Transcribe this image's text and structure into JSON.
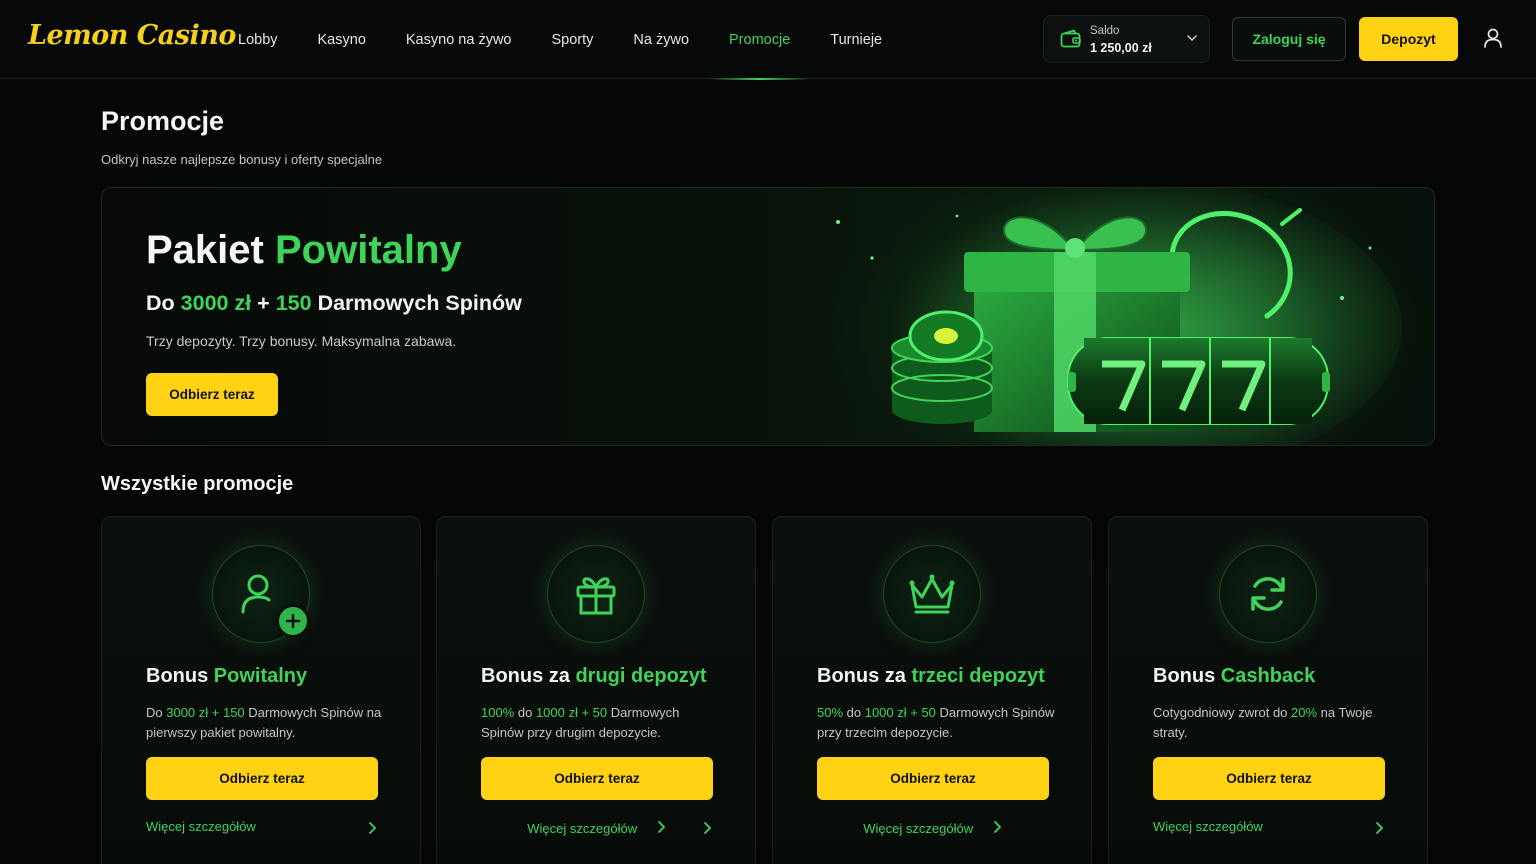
{
  "header": {
    "logo": "Lemon Casino",
    "nav": [
      "Lobby",
      "Kasyno",
      "Kasyno na żywo",
      "Sporty",
      "Na żywo",
      "Promocje",
      "Turnieje"
    ],
    "active_nav": "Promocje",
    "balance_label": "Saldo",
    "balance_value": "1 250,00 zł",
    "login_label": "Zaloguj się",
    "deposit_label": "Depozyt"
  },
  "page": {
    "title": "Promocje",
    "subtitle": "Odkryj nasze najlepsze bonusy i oferty specjalne"
  },
  "hero": {
    "title_white": "Pakiet",
    "title_green": "Powitalny",
    "offer_prefix": "Do",
    "offer_amount": "3000 zł",
    "offer_plus": "+",
    "offer_spins": "150",
    "offer_suffix": "Darmowych Spinów",
    "description": "Trzy depozyty. Trzy bonusy. Maksymalna zabawa.",
    "button": "Odbierz teraz"
  },
  "section_title": "Wszystkie promocje",
  "cards": [
    {
      "icon": "user-plus-icon",
      "title_white": "Bonus",
      "title_green": "Powitalny",
      "desc": [
        "Do ",
        "3000 zł + 150",
        " Darmowych Spinów na pierwszy pakiet powitalny."
      ],
      "button": "Odbierz teraz",
      "link": "Więcej szczegółów"
    },
    {
      "icon": "gift-icon",
      "title_white": "Bonus za",
      "title_green": "drugi depozyt",
      "desc": [
        "",
        "100%",
        " do ",
        "1000 zł + 50",
        " Darmowych Spinów przy drugim depozycie."
      ],
      "button": "Odbierz teraz",
      "link": "Więcej szczegółów"
    },
    {
      "icon": "crown-icon",
      "title_white": "Bonus za",
      "title_green": "trzeci depozyt",
      "desc": [
        "",
        "50%",
        " do ",
        "1000 zł + 50",
        " Darmowych Spinów przy trzecim depozycie."
      ],
      "button": "Odbierz teraz",
      "link": "Więcej szczegółów"
    },
    {
      "icon": "refresh-icon",
      "title_white": "Bonus",
      "title_green": "Cashback",
      "desc": [
        "Cotygodniowy zwrot do ",
        "20%",
        " na Twoje straty."
      ],
      "button": "Odbierz teraz",
      "link": "Więcej szczegółów"
    }
  ],
  "colors": {
    "accent_green": "#3fd35a",
    "accent_yellow": "#ffd314",
    "background": "#050706"
  }
}
